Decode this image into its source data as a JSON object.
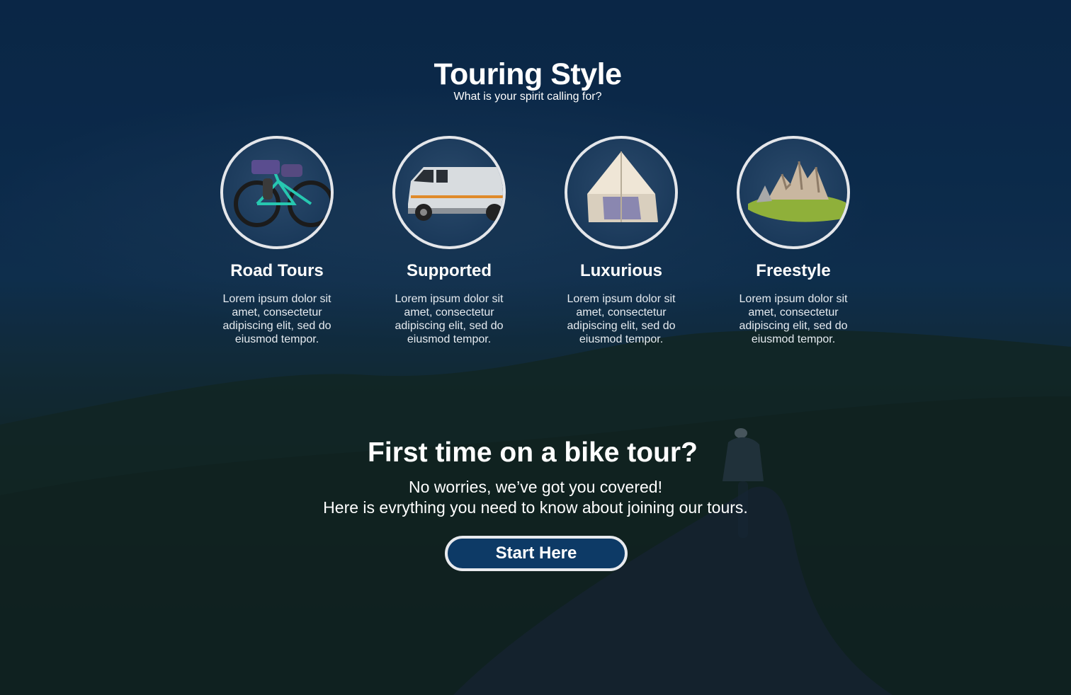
{
  "header": {
    "title": "Touring Style",
    "subtitle": "What is your spirit calling for?"
  },
  "styles": [
    {
      "title": "Road Tours",
      "text": "Lorem ipsum dolor sit amet, consectetur adipiscing elit, sed do eiusmod tempor.",
      "icon": "bicycle-icon"
    },
    {
      "title": "Supported",
      "text": "Lorem ipsum dolor sit amet, consectetur adipiscing elit, sed do eiusmod tempor.",
      "icon": "van-icon"
    },
    {
      "title": "Luxurious",
      "text": "Lorem ipsum dolor sit amet, consectetur adipiscing elit, sed do eiusmod tempor.",
      "icon": "tent-icon"
    },
    {
      "title": "Freestyle",
      "text": "Lorem ipsum dolor sit amet, consectetur adipiscing elit, sed do eiusmod tempor.",
      "icon": "mountain-icon"
    }
  ],
  "cta": {
    "title": "First time on a bike tour?",
    "line1": "No worries, we’ve got you covered!",
    "line2": "Here is evrything you need to know about joining our tours.",
    "button_label": "Start Here"
  },
  "colors": {
    "button_bg": "#0d3a66",
    "button_border": "#e8eaee",
    "circle_border": "#e4e6ea"
  }
}
